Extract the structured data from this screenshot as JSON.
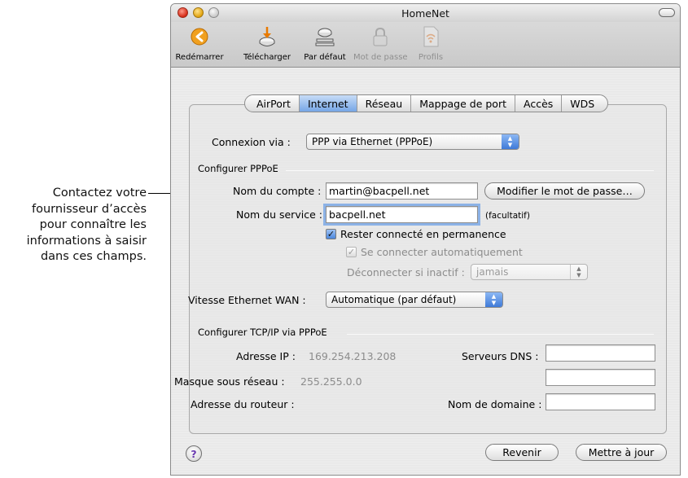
{
  "callout": {
    "lines": [
      "Contactez votre",
      "fournisseur d’accès",
      "pour connaître les",
      "informations à saisir",
      "dans ces champs."
    ]
  },
  "window": {
    "title": "HomeNet"
  },
  "toolbar": {
    "items": [
      {
        "label": "Redémarrer",
        "icon": "restart-icon",
        "disabled": false
      },
      {
        "label": "Télécharger",
        "icon": "download-icon",
        "disabled": false
      },
      {
        "label": "Par défaut",
        "icon": "default-icon",
        "disabled": false
      },
      {
        "label": "Mot de passe",
        "icon": "lock-icon",
        "disabled": true
      },
      {
        "label": "Profils",
        "icon": "wifi-profile-icon",
        "disabled": true
      }
    ]
  },
  "tabs": [
    "AirPort",
    "Internet",
    "Réseau",
    "Mappage de port",
    "Accès",
    "WDS"
  ],
  "active_tab": "Internet",
  "connection": {
    "label": "Connexion via :",
    "value": "PPP via Ethernet (PPPoE)"
  },
  "pppoe": {
    "section_title": "Configurer PPPoE",
    "account_label": "Nom du compte :",
    "account_value": "martin@bacpell.net",
    "change_password_button": "Modifier le mot de passe…",
    "service_label": "Nom du service :",
    "service_value": "bacpell.net",
    "optional_note": "(facultatif)",
    "stay_connected": "Rester connecté en permanence",
    "auto_connect": "Se connecter automatiquement",
    "disconnect_label": "Déconnecter si inactif :",
    "disconnect_value": "jamais"
  },
  "ethernet": {
    "label": "Vitesse Ethernet WAN :",
    "value": "Automatique (par défaut)"
  },
  "tcpip": {
    "section_title": "Configurer TCP/IP via PPPoE",
    "ip_label": "Adresse IP :",
    "ip_value": "169.254.213.208",
    "mask_label": "Masque sous réseau :",
    "mask_value": "255.255.0.0",
    "router_label": "Adresse du routeur :",
    "dns_label": "Serveurs DNS :",
    "domain_label": "Nom de domaine :"
  },
  "footer": {
    "help_symbol": "?",
    "revert_button": "Revenir",
    "update_button": "Mettre à jour"
  }
}
